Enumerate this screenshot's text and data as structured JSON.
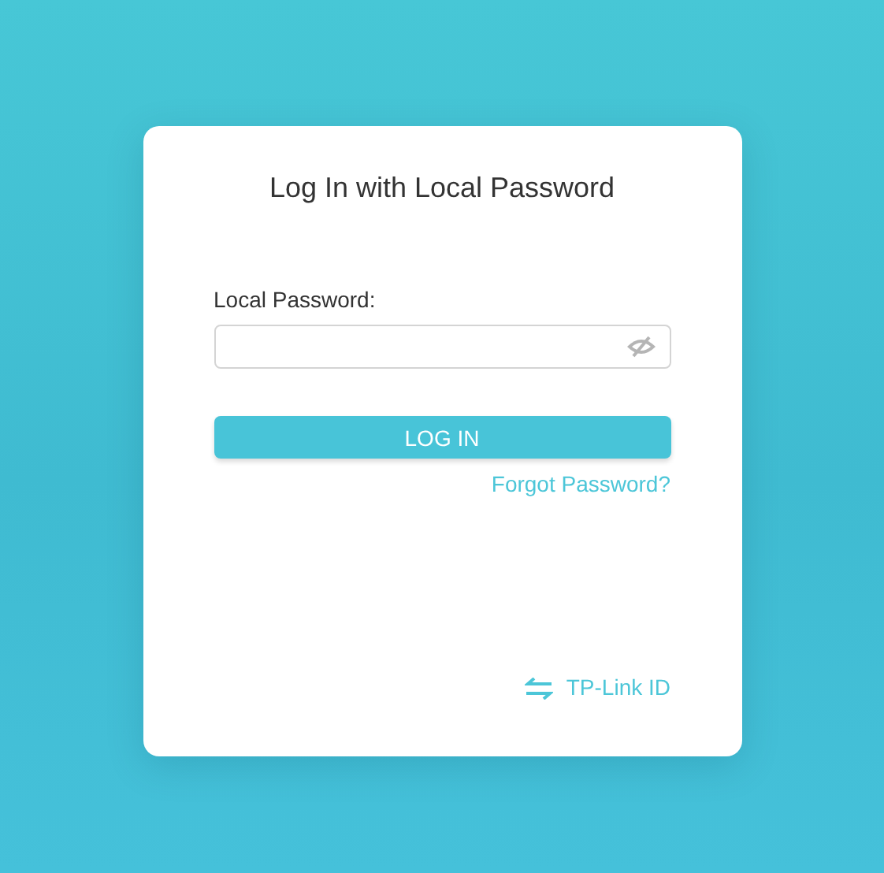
{
  "dialog": {
    "title": "Log In with Local Password"
  },
  "password_field": {
    "label": "Local Password:"
  },
  "login_button": {
    "label": "LOG IN"
  },
  "forgot_link": {
    "label": "Forgot Password?"
  },
  "switch_link": {
    "label": "TP-Link ID"
  }
}
